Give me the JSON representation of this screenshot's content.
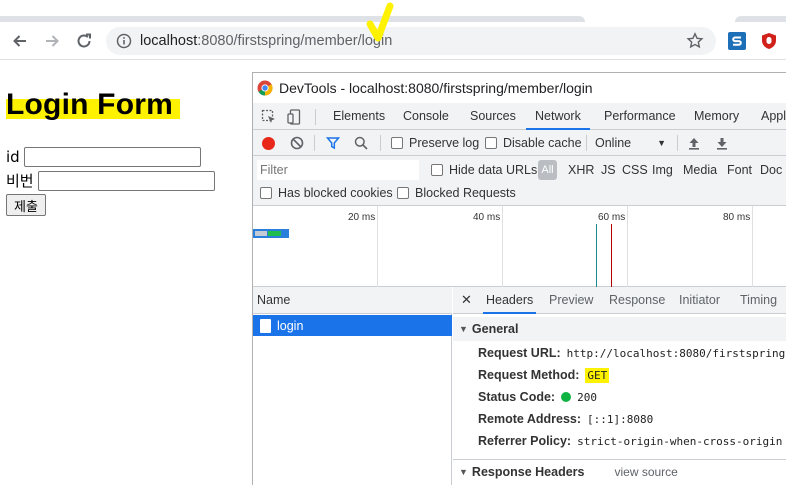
{
  "browser": {
    "url_host": "localhost",
    "url_rest": ":8080/firstspring/member/login"
  },
  "page": {
    "title": "Login Form",
    "fields": [
      {
        "label": "id",
        "value": ""
      },
      {
        "label": "비번",
        "value": ""
      }
    ],
    "submit_label": "제출"
  },
  "devtools": {
    "title": "DevTools - localhost:8080/firstspring/member/login",
    "tabs": [
      "Elements",
      "Console",
      "Sources",
      "Network",
      "Performance",
      "Memory",
      "Appl"
    ],
    "active_tab": "Network",
    "toolbar": {
      "preserve_log": "Preserve log",
      "disable_cache": "Disable cache",
      "throttling": "Online"
    },
    "filter": {
      "placeholder": "Filter",
      "hide_data_urls": "Hide data URLs",
      "all": "All",
      "types": [
        "XHR",
        "JS",
        "CSS",
        "Img",
        "Media",
        "Font",
        "Doc"
      ],
      "has_blocked_cookies": "Has blocked cookies",
      "blocked_requests": "Blocked Requests"
    },
    "overview": {
      "ticks": [
        "20 ms",
        "40 ms",
        "60 ms",
        "80 ms"
      ]
    },
    "requests": {
      "header": "Name",
      "items": [
        "login"
      ]
    },
    "detail": {
      "tabs": [
        "Headers",
        "Preview",
        "Response",
        "Initiator",
        "Timing"
      ],
      "active_tab": "Headers",
      "general_title": "General",
      "general": [
        {
          "key": "Request URL:",
          "value": "http://localhost:8080/firstspring/m"
        },
        {
          "key": "Request Method:",
          "value": "GET"
        },
        {
          "key": "Status Code:",
          "value": "200"
        },
        {
          "key": "Remote Address:",
          "value": "[::1]:8080"
        },
        {
          "key": "Referrer Policy:",
          "value": "strict-origin-when-cross-origin"
        }
      ],
      "response_headers_title": "Response Headers",
      "view_source": "view source"
    }
  },
  "colors": {
    "accent": "#1a73e8",
    "highlight": "#fff200",
    "status_ok": "#0eb341",
    "record": "#e8281b"
  }
}
